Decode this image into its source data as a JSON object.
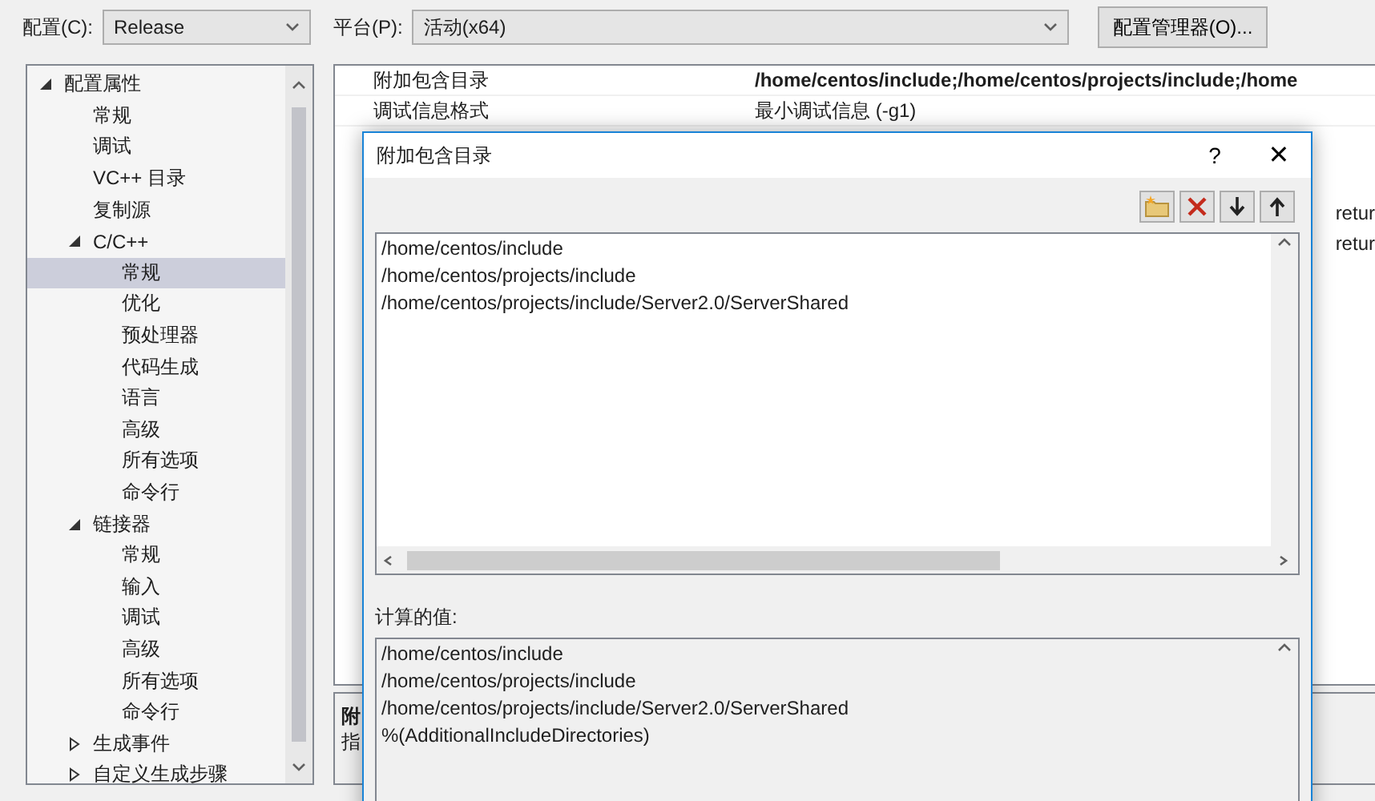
{
  "toolbar": {
    "config_label": "配置(C):",
    "config_value": "Release",
    "platform_label": "平台(P):",
    "platform_value": "活动(x64)",
    "manager_button": "配置管理器(O)..."
  },
  "tree": [
    {
      "label": "配置属性",
      "expanded": true,
      "selected": false,
      "children": [
        {
          "label": "常规",
          "selected": false
        },
        {
          "label": "调试",
          "selected": false
        },
        {
          "label": "VC++ 目录",
          "selected": false
        },
        {
          "label": "复制源",
          "selected": false
        },
        {
          "label": "C/C++",
          "expanded": true,
          "selected": false,
          "children": [
            {
              "label": "常规",
              "selected": true
            },
            {
              "label": "优化",
              "selected": false
            },
            {
              "label": "预处理器",
              "selected": false
            },
            {
              "label": "代码生成",
              "selected": false
            },
            {
              "label": "语言",
              "selected": false
            },
            {
              "label": "高级",
              "selected": false
            },
            {
              "label": "所有选项",
              "selected": false
            },
            {
              "label": "命令行",
              "selected": false
            }
          ]
        },
        {
          "label": "链接器",
          "expanded": true,
          "selected": false,
          "children": [
            {
              "label": "常规",
              "selected": false
            },
            {
              "label": "输入",
              "selected": false
            },
            {
              "label": "调试",
              "selected": false
            },
            {
              "label": "高级",
              "selected": false
            },
            {
              "label": "所有选项",
              "selected": false
            },
            {
              "label": "命令行",
              "selected": false
            }
          ]
        },
        {
          "label": "生成事件",
          "expanded": false,
          "selected": false
        },
        {
          "label": "自定义生成步骤",
          "expanded": false,
          "selected": false
        }
      ]
    }
  ],
  "properties": [
    {
      "name": "附加包含目录",
      "value": "/home/centos/include;/home/centos/projects/include;/home",
      "bold": true
    },
    {
      "name": "调试信息格式",
      "value": "最小调试信息 (-g1)",
      "bold": false
    }
  ],
  "hidden_fragments": [
    "retur",
    "retur"
  ],
  "description": {
    "title": "附",
    "text": "指"
  },
  "dialog": {
    "title": "附加包含目录",
    "help": "?",
    "close": "✕",
    "entries": [
      "/home/centos/include",
      "/home/centos/projects/include",
      "/home/centos/projects/include/Server2.0/ServerShared"
    ],
    "computed_label": "计算的值:",
    "computed": [
      "/home/centos/include",
      "/home/centos/projects/include",
      "/home/centos/projects/include/Server2.0/ServerShared",
      "%(AdditionalIncludeDirectories)"
    ]
  }
}
